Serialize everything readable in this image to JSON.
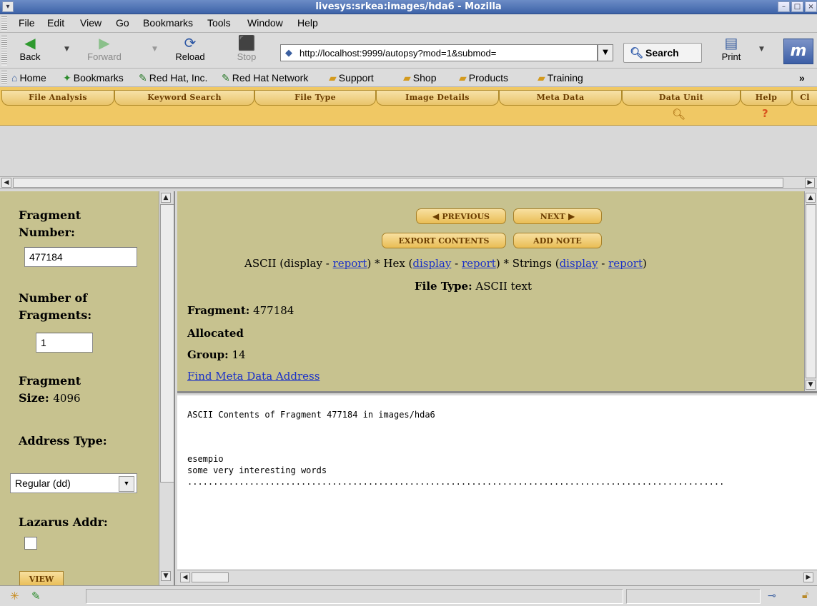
{
  "window": {
    "title": "livesys:srkea:images/hda6 - Mozilla"
  },
  "menubar": [
    "File",
    "Edit",
    "View",
    "Go",
    "Bookmarks",
    "Tools",
    "Window",
    "Help"
  ],
  "navbar": {
    "back": "Back",
    "forward": "Forward",
    "reload": "Reload",
    "stop": "Stop",
    "print": "Print",
    "url": "http://localhost:9999/autopsy?mod=1&submod=",
    "search": "Search"
  },
  "personal_toolbar": [
    "Home",
    "Bookmarks",
    "Red Hat, Inc.",
    "Red Hat Network",
    "Support",
    "Shop",
    "Products",
    "Training"
  ],
  "personal_toolbar_more": "»",
  "tabs": [
    "File Analysis",
    "Keyword Search",
    "File Type",
    "Image Details",
    "Meta Data",
    "Data Unit",
    "Help",
    "Cl"
  ],
  "tab_help_glyph": "?",
  "left": {
    "fragment_number_label_1": "Fragment",
    "fragment_number_label_2": "Number:",
    "fragment_number": "477184",
    "num_fragments_label_1": "Number of",
    "num_fragments_label_2": "Fragments:",
    "num_fragments": "1",
    "frag_size_label_1": "Fragment",
    "frag_size_label_2": "Size:",
    "frag_size": "4096",
    "address_type_label": "Address Type:",
    "address_type": "Regular (dd)",
    "lazarus_label": "Lazarus Addr:",
    "view_button": "View"
  },
  "upper": {
    "previous": "Previous",
    "next": "Next",
    "export": "Export Contents",
    "add_note": "Add Note",
    "mode": {
      "ascii_prefix": "ASCII (display - ",
      "ascii_report": "report",
      "hex_prefix": ") * Hex (",
      "hex_display": "display",
      "dash": " - ",
      "hex_report": "report",
      "strings_prefix": ") * Strings (",
      "strings_display": "display",
      "strings_report": "report",
      "close": ")"
    },
    "file_type_label": "File Type:",
    "file_type": "ASCII text",
    "fragment_label": "Fragment:",
    "fragment": "477184",
    "allocated": "Allocated",
    "group_label": "Group:",
    "group": "14",
    "find_meta": "Find Meta Data Address"
  },
  "lower": {
    "heading": "ASCII Contents of Fragment 477184 in images/hda6",
    "line1": "esempio",
    "line2": "some very interesting words",
    "dots": "........................................................................................................"
  },
  "colors": {
    "frame_bg": "#c7c28f",
    "tab_bar": "#f0c864",
    "tab_text": "#6b3d00",
    "link": "#1a30c8"
  }
}
